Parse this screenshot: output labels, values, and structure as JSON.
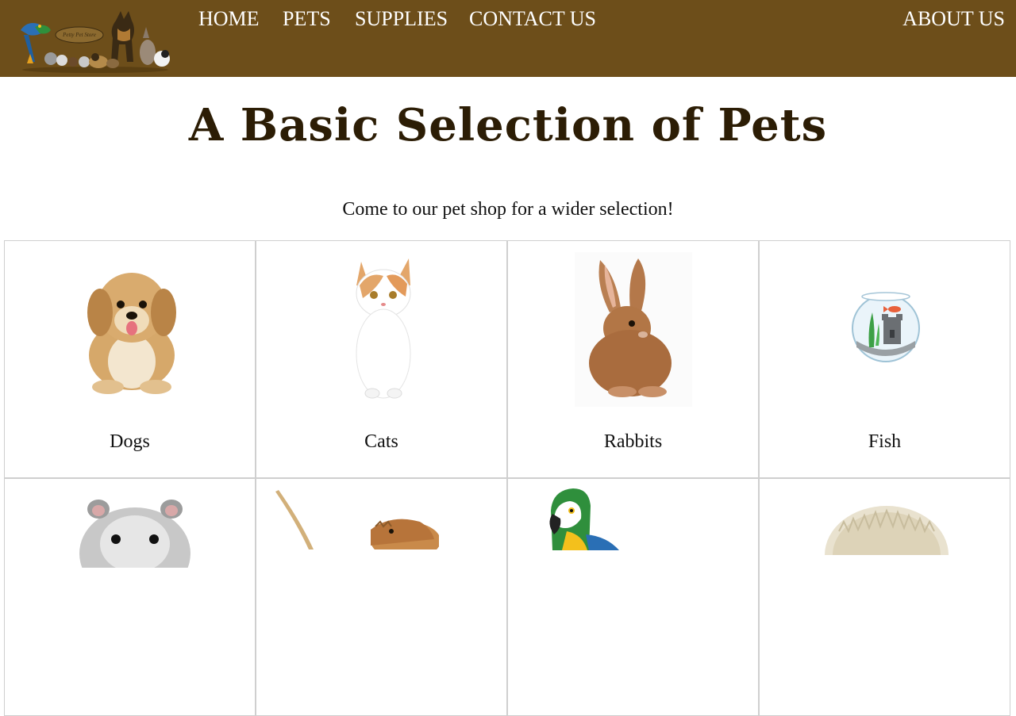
{
  "header": {
    "logo_text": "Petty Pet Store",
    "nav": [
      {
        "label": "HOME"
      },
      {
        "label": "PETS"
      },
      {
        "label": "SUPPLIES"
      },
      {
        "label": "CONTACT US"
      },
      {
        "label": "ABOUT US"
      }
    ],
    "background": "#6d4e1a"
  },
  "main": {
    "title": "A Basic Selection of Pets",
    "subtitle": "Come to our pet shop for a wider selection!",
    "pets": [
      {
        "label": "Dogs",
        "icon": "dog-image"
      },
      {
        "label": "Cats",
        "icon": "cat-image"
      },
      {
        "label": "Rabbits",
        "icon": "rabbit-image"
      },
      {
        "label": "Fish",
        "icon": "fishbowl-image"
      },
      {
        "label": "",
        "icon": "hamster-image"
      },
      {
        "label": "",
        "icon": "bearded-dragon-image"
      },
      {
        "label": "",
        "icon": "parrot-image"
      },
      {
        "label": "",
        "icon": "hedgehog-image"
      }
    ]
  },
  "colors": {
    "title": "#2c1d05",
    "cell_border": "#cfcfcf"
  }
}
